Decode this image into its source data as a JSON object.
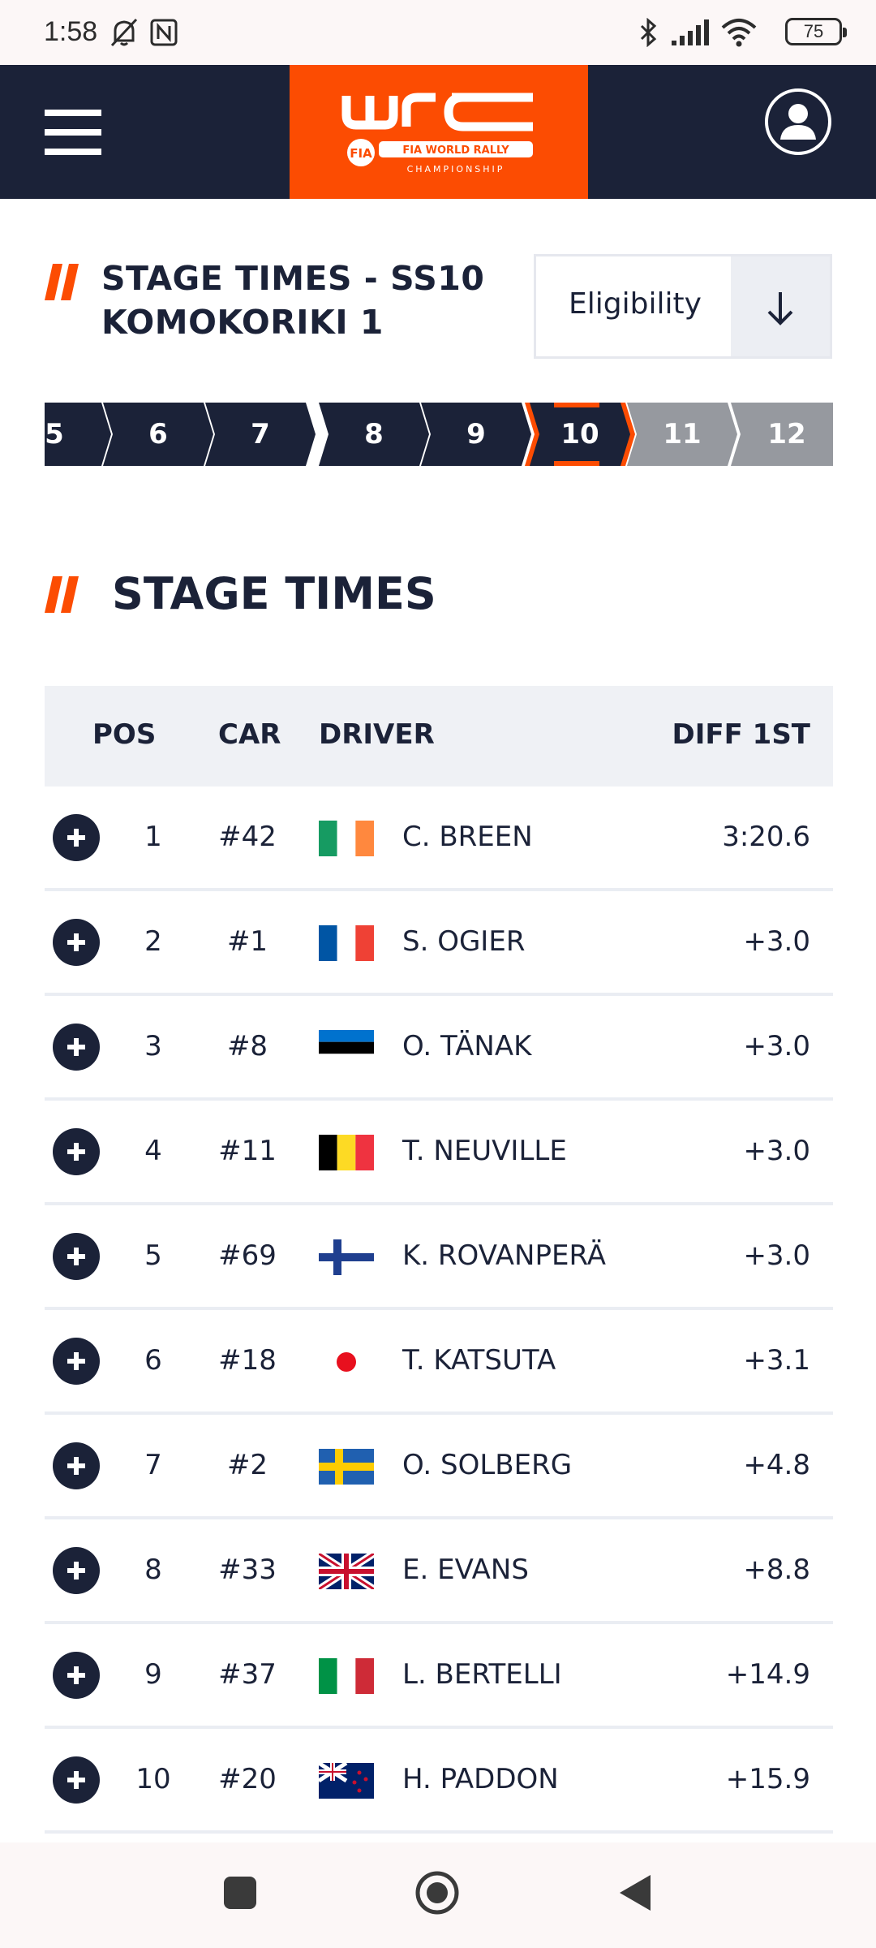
{
  "status_bar": {
    "time": "1:58",
    "battery": "75"
  },
  "header": {
    "logo_alt": "WRC FIA World Rally Championship"
  },
  "stage": {
    "title_line1": "STAGE TIMES - SS10",
    "title_line2": "KOMOKORIKI 1",
    "eligibility_label": "Eligibility"
  },
  "stage_nav": [
    {
      "label": "5",
      "state": "done"
    },
    {
      "label": "6",
      "state": "done"
    },
    {
      "label": "7",
      "state": "done"
    },
    {
      "label": "8",
      "state": "done"
    },
    {
      "label": "9",
      "state": "done"
    },
    {
      "label": "10",
      "state": "selected"
    },
    {
      "label": "11",
      "state": "upcoming"
    },
    {
      "label": "12",
      "state": "upcoming"
    }
  ],
  "section_title": "STAGE TIMES",
  "table": {
    "headers": {
      "pos": "POS",
      "car": "CAR",
      "driver": "DRIVER",
      "diff": "DIFF 1ST"
    },
    "rows": [
      {
        "pos": "1",
        "car": "#42",
        "driver": "C. BREEN",
        "diff": "3:20.6",
        "flag": "ireland"
      },
      {
        "pos": "2",
        "car": "#1",
        "driver": "S. OGIER",
        "diff": "+3.0",
        "flag": "france"
      },
      {
        "pos": "3",
        "car": "#8",
        "driver": "O. TÄNAK",
        "diff": "+3.0",
        "flag": "estonia"
      },
      {
        "pos": "4",
        "car": "#11",
        "driver": "T. NEUVILLE",
        "diff": "+3.0",
        "flag": "belgium"
      },
      {
        "pos": "5",
        "car": "#69",
        "driver": "K. ROVANPERÄ",
        "diff": "+3.0",
        "flag": "finland"
      },
      {
        "pos": "6",
        "car": "#18",
        "driver": "T. KATSUTA",
        "diff": "+3.1",
        "flag": "japan"
      },
      {
        "pos": "7",
        "car": "#2",
        "driver": "O. SOLBERG",
        "diff": "+4.8",
        "flag": "sweden"
      },
      {
        "pos": "8",
        "car": "#33",
        "driver": "E. EVANS",
        "diff": "+8.8",
        "flag": "united-kingdom"
      },
      {
        "pos": "9",
        "car": "#37",
        "driver": "L. BERTELLI",
        "diff": "+14.9",
        "flag": "italy"
      },
      {
        "pos": "10",
        "car": "#20",
        "driver": "H. PADDON",
        "diff": "+15.9",
        "flag": "new-zealand"
      }
    ]
  },
  "colors": {
    "navy": "#1b2238",
    "orange": "#fc4c02",
    "grey": "#96999f"
  }
}
